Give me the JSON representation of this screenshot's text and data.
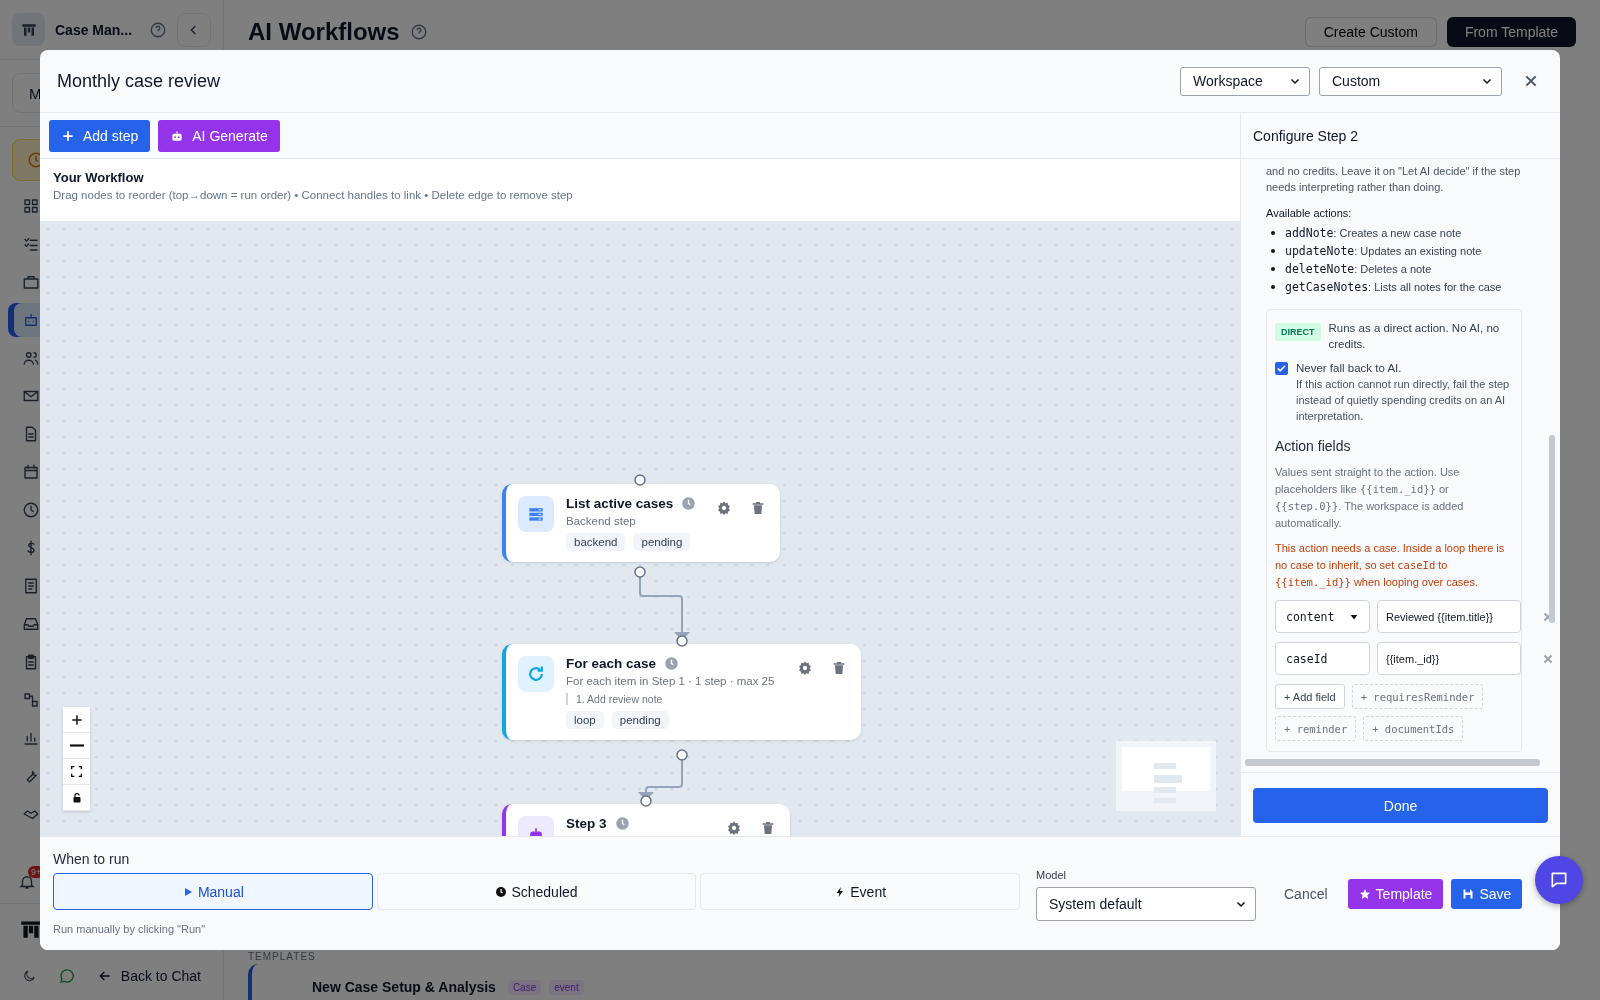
{
  "app": {
    "brand": "Case Man...",
    "workspace_initial": "M",
    "page_title": "AI Workflows",
    "header_buttons": [
      {
        "label": "Create Custom",
        "kind": "secondary"
      },
      {
        "label": "From Template",
        "kind": "primary"
      }
    ],
    "nav_items": [
      {
        "kind": "grid",
        "selected": false
      },
      {
        "kind": "checklist",
        "selected": false
      },
      {
        "kind": "briefcase",
        "selected": false
      },
      {
        "kind": "robot",
        "selected": true
      },
      {
        "kind": "users",
        "selected": false
      },
      {
        "kind": "mail",
        "selected": false
      },
      {
        "kind": "document",
        "selected": false
      },
      {
        "kind": "calendar",
        "selected": false
      },
      {
        "kind": "clock",
        "selected": false
      },
      {
        "kind": "dollar",
        "selected": false
      },
      {
        "kind": "notes",
        "selected": false
      },
      {
        "kind": "inbox",
        "selected": false
      },
      {
        "kind": "clipboard",
        "selected": false
      },
      {
        "kind": "flow",
        "selected": false
      },
      {
        "kind": "chart",
        "selected": false
      },
      {
        "kind": "wrench",
        "selected": false
      },
      {
        "kind": "handshake",
        "selected": false
      }
    ],
    "notification_badge": "9+",
    "back_link": "Back to Chat",
    "templates_label": "TEMPLATES",
    "template": {
      "title": "New Case Setup & Analysis",
      "tags": [
        "Case",
        "event"
      ]
    }
  },
  "modal": {
    "title": "Monthly case review",
    "scope_select": "Workspace",
    "type_select": "Custom",
    "toolbar": [
      {
        "label": "Add step",
        "kind": "add"
      },
      {
        "label": "AI Generate",
        "kind": "ai"
      }
    ],
    "workflow_heading": "Your Workflow",
    "workflow_hint": "Drag nodes to reorder (top→down = run order) • Connect handles to link • Delete edge to remove step",
    "nodes": [
      {
        "kind": "backend",
        "title": "List active cases",
        "subtitle": "Backend step",
        "tags": [
          "backend",
          "pending"
        ]
      },
      {
        "kind": "loop",
        "title": "For each case",
        "subtitle": "For each item in Step 1 · 1 step · max 25",
        "substeps": [
          "1. Add review note"
        ],
        "tags": [
          "loop",
          "pending"
        ]
      },
      {
        "kind": "ai",
        "title": "Step 3"
      }
    ],
    "panel": {
      "title": "Configure Step 2",
      "intro": "and no credits. Leave it on \"Let AI decide\" if the step needs interpreting rather than doing.",
      "actions_heading": "Available actions:",
      "actions": [
        [
          {
            "kind": "code",
            "text": "addNote"
          },
          {
            "kind": "text",
            "text": ": Creates a new case note"
          }
        ],
        [
          {
            "kind": "code",
            "text": "updateNote"
          },
          {
            "kind": "text",
            "text": ": Updates an existing note"
          }
        ],
        [
          {
            "kind": "code",
            "text": "deleteNote"
          },
          {
            "kind": "text",
            "text": ": Deletes a note"
          }
        ],
        [
          {
            "kind": "code",
            "text": "getCaseNotes"
          },
          {
            "kind": "text",
            "text": ": Lists all notes for the case"
          }
        ]
      ],
      "mode_badge": "DIRECT",
      "mode_text": "Runs as a direct action. No AI, no credits.",
      "fallback": {
        "checked": true,
        "label": "Never fall back to AI.",
        "help": "If this action cannot run directly, fail the step instead of quietly spending credits on an AI interpretation."
      },
      "fields_heading": "Action fields",
      "fields_hint": [
        {
          "kind": "text",
          "text": "Values sent straight to the action. Use placeholders like "
        },
        {
          "kind": "code",
          "text": "{{item._id}}"
        },
        {
          "kind": "text",
          "text": " or "
        },
        {
          "kind": "code",
          "text": "{{step.0}}"
        },
        {
          "kind": "text",
          "text": ". The workspace is added automatically."
        }
      ],
      "warning": [
        {
          "kind": "text",
          "text": "This action needs a case. Inside a loop there is no case to inherit, so set "
        },
        {
          "kind": "code",
          "text": "caseId"
        },
        {
          "kind": "text",
          "text": " to "
        },
        {
          "kind": "code",
          "text": "{{item._id}}"
        },
        {
          "kind": "text",
          "text": " when looping over cases."
        }
      ],
      "fields": [
        {
          "kind": "select",
          "key": "content",
          "value": "Reviewed {{item.title}}"
        },
        {
          "kind": "input",
          "key": "caseId",
          "value": "{{item._id}}"
        }
      ],
      "add_field": "+ Add field",
      "suggestions": [
        "+ requiresReminder",
        "+ reminder",
        "+ documentIds"
      ],
      "done": "Done"
    },
    "when_label": "When to run",
    "triggers": [
      {
        "kind": "manual",
        "label": "Manual",
        "selected": true
      },
      {
        "kind": "scheduled",
        "label": "Scheduled",
        "selected": false
      },
      {
        "kind": "event",
        "label": "Event",
        "selected": false
      }
    ],
    "trigger_hint": "Run manually by clicking \"Run\"",
    "model_label": "Model",
    "model_select": "System default",
    "cancel": "Cancel",
    "template_button": "Template",
    "save_button": "Save"
  }
}
